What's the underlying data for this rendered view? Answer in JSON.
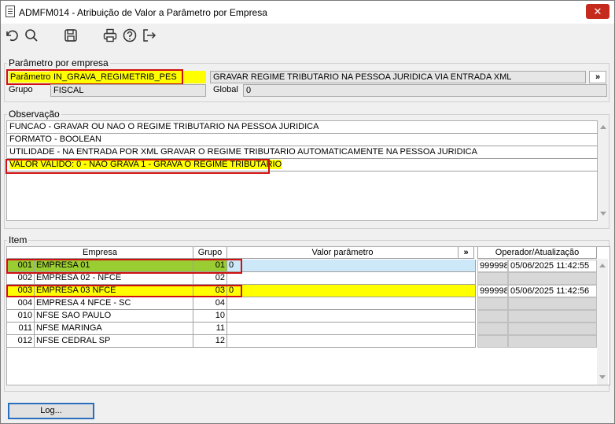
{
  "window": {
    "title": "ADMFM014 - Atribuição de Valor a Parâmetro por Empresa",
    "close_glyph": "✕"
  },
  "toolbar": {
    "icons": [
      "undo-icon",
      "search-icon",
      "save-icon",
      "print-icon",
      "help-icon",
      "exit-icon"
    ]
  },
  "param_group": {
    "title": "Parâmetro por empresa",
    "parametro_label": "Parâmetro",
    "parametro_value": "IN_GRAVA_REGIMETRIB_PES",
    "description": "GRAVAR REGIME TRIBUTARIO NA PESSOA JURIDICA VIA  ENTRADA XML",
    "more_label": "»",
    "grupo_label": "Grupo",
    "grupo_value": "FISCAL",
    "global_label": "Global",
    "global_value": "0"
  },
  "observacao": {
    "title": "Observação",
    "lines": [
      "FUNCAO - GRAVAR OU NAO O REGIME TRIBUTARIO NA PESSOA JURIDICA",
      "FORMATO - BOOLEAN",
      "UTILIDADE - NA ENTRADA POR XML GRAVAR O REGIME TRIBUTARIO AUTOMATICAMENTE NA PESSOA JURIDICA",
      "VALOR VALIDO: 0 - NAO GRAVA 1 - GRAVA O REGIME TRIBUTARIO"
    ]
  },
  "item": {
    "title": "Item",
    "headers": {
      "empresa": "Empresa",
      "grupo": "Grupo",
      "valor": "Valor parâmetro",
      "more": "»",
      "operador": "Operador/Atualização"
    },
    "rows": [
      {
        "code": "001",
        "name": "EMPRESA 01",
        "grupo": "01",
        "valor": "0",
        "operador": "999998",
        "data": "05/06/2025 11:42:55"
      },
      {
        "code": "002",
        "name": "EMPRESA 02 - NFCE",
        "grupo": "02",
        "valor": "",
        "operador": "",
        "data": ""
      },
      {
        "code": "003",
        "name": "EMPRESA 03 NFCE",
        "grupo": "03",
        "valor": "0",
        "operador": "999998",
        "data": "05/06/2025 11:42:56"
      },
      {
        "code": "004",
        "name": "EMPRESA 4 NFCE - SC",
        "grupo": "04",
        "valor": "",
        "operador": "",
        "data": ""
      },
      {
        "code": "010",
        "name": "NFSE SAO PAULO",
        "grupo": "10",
        "valor": "",
        "operador": "",
        "data": ""
      },
      {
        "code": "011",
        "name": "NFSE MARINGA",
        "grupo": "11",
        "valor": "",
        "operador": "",
        "data": ""
      },
      {
        "code": "012",
        "name": "NFSE CEDRAL SP",
        "grupo": "12",
        "valor": "",
        "operador": "",
        "data": ""
      }
    ]
  },
  "footer": {
    "log_label": "Log..."
  },
  "colors": {
    "highlight": "#ffff00",
    "selected_row": "#9acd32",
    "selected_valor": "#cde8f8",
    "annotation_border": "#d01010"
  }
}
